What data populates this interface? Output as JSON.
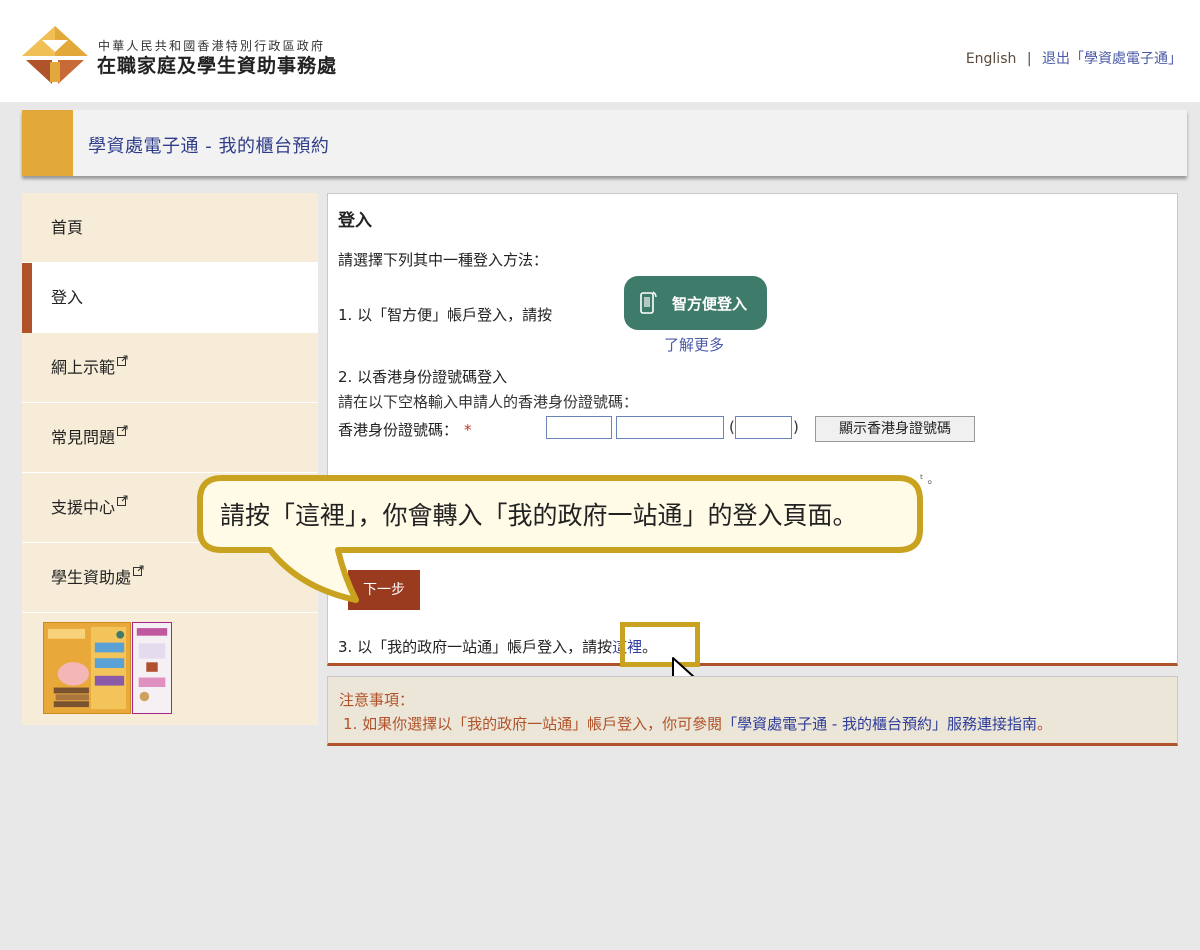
{
  "header": {
    "org_line_small": "中華人民共和國香港特別行政區政府",
    "org_line_big": "在職家庭及學生資助事務處",
    "english_link": "English",
    "separator": "|",
    "logout_link": "退出「學資處電子通」"
  },
  "banner": {
    "title": "學資處電子通 - 我的櫃台預約"
  },
  "sidebar": {
    "items": [
      {
        "label": "首頁",
        "external": false,
        "active": false
      },
      {
        "label": "登入",
        "external": false,
        "active": true
      },
      {
        "label": "網上示範",
        "external": true,
        "active": false
      },
      {
        "label": "常見問題",
        "external": true,
        "active": false
      },
      {
        "label": "支援中心",
        "external": true,
        "active": false
      },
      {
        "label": "學生資助處",
        "external": true,
        "active": false
      }
    ]
  },
  "main": {
    "heading": "登入",
    "choose_text": "請選擇下列其中一種登入方法：",
    "method1_text": "1. 以「智方便」帳戶登入，請按",
    "iam_button": "智方便登入",
    "learn_more": "了解更多",
    "method2_title": "2. 以香港身份證號碼登入",
    "method2_instruction": "請在以下空格輸入申請人的香港身份證號碼：",
    "hkid_label": "香港身份證號碼：",
    "required_mark": "*",
    "paren_open": "(",
    "paren_close": ")",
    "show_hkid_button": "顯示香港身證號碼",
    "next_button": "下一步",
    "method3_prefix": "3. 以「我的政府一站通」帳戶登入，請按",
    "method3_link": "這裡",
    "method3_suffix": "。",
    "stray_text": "ᵗ 。"
  },
  "notice": {
    "title": "注意事項：",
    "item_prefix": "1. 如果你選擇以「我的政府一站通」帳戶登入，你可參閱",
    "item_link": "「學資處電子通 - 我的櫃台預約」服務連接指南",
    "item_suffix": "。"
  },
  "callout": {
    "text": "請按「這裡」，你會轉入「我的政府一站通」的登入頁面。"
  },
  "colors": {
    "accent_gold": "#e3a83a",
    "accent_brown": "#b0522a",
    "iam_green": "#3f7b6a",
    "link_blue": "#2f3d9a",
    "callout_border": "#c9a21f"
  }
}
